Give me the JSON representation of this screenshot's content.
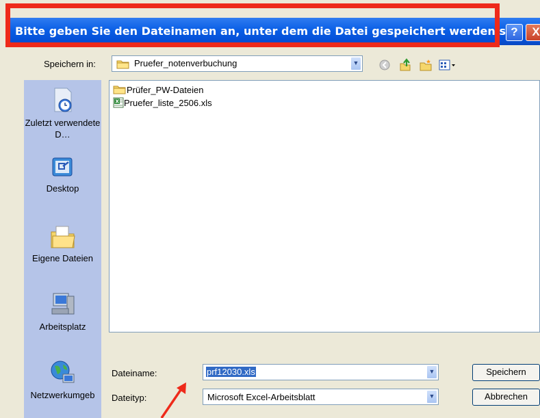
{
  "dialog": {
    "title": "Bitte geben Sie den Dateinamen an, unter dem die Datei gespeichert werden s…",
    "help_label": "?",
    "close_label": "X"
  },
  "location": {
    "label": "Speichern in:",
    "value": "Pruefer_notenverbuchung"
  },
  "places": [
    {
      "label": "Zuletzt verwendete D…",
      "icon": "recent-documents-icon"
    },
    {
      "label": "Desktop",
      "icon": "desktop-icon"
    },
    {
      "label": "Eigene Dateien",
      "icon": "my-documents-icon"
    },
    {
      "label": "Arbeitsplatz",
      "icon": "my-computer-icon"
    },
    {
      "label": "Netzwerkumgeb",
      "icon": "network-icon"
    }
  ],
  "files": [
    {
      "name": "Prüfer_PW-Dateien",
      "type": "folder"
    },
    {
      "name": "Pruefer_liste_2506.xls",
      "type": "excel"
    }
  ],
  "filename": {
    "label": "Dateiname:",
    "value": "prf12030.xls"
  },
  "filetype": {
    "label": "Dateityp:",
    "value": "Microsoft Excel-Arbeitsblatt"
  },
  "buttons": {
    "save": "Speichern",
    "cancel": "Abbrechen"
  },
  "colors": {
    "highlight": "#ee2a1a",
    "titlebar": "#0a5fe6",
    "dialog_bg": "#ece9d8",
    "places_bg": "#b5c4e8"
  }
}
